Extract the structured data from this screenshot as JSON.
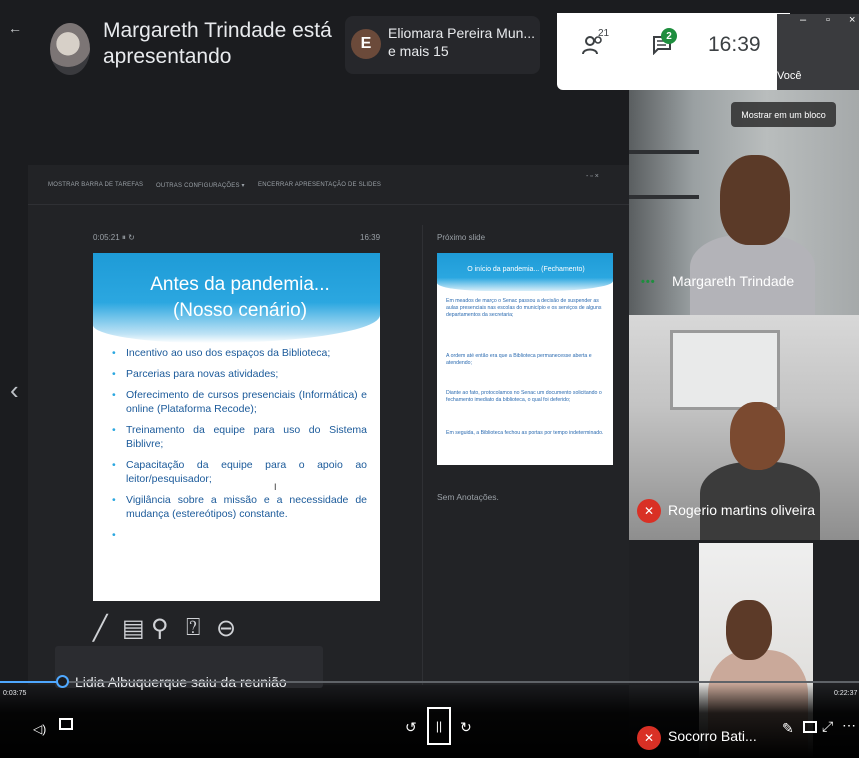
{
  "header": {
    "presenter": "Margareth Trindade está apresentando",
    "participant_name": "Eliomara Pereira Mun...",
    "participant_more": "e mais 15",
    "participant_initial": "E",
    "people_count": "21",
    "chat_badge": "2",
    "time": "16:39",
    "self_label": "Você"
  },
  "presentation": {
    "toolbar": [
      "MOSTRAR BARRA DE TAREFAS",
      "OUTRAS CONFIGURAÇÕES ▾",
      "ENCERRAR APRESENTAÇÃO DE SLIDES"
    ],
    "window_controls": "-  ▫  ×",
    "timer": "0:05:21  ⏸  ↻",
    "clock": "16:39",
    "next_label": "Próximo slide",
    "notes_label": "Sem Anotações.",
    "main_slide": {
      "title": "Antes da pandemia... (Nosso cenário)",
      "bullets": [
        "Incentivo ao uso dos espaços da Biblioteca;",
        "Parcerias para novas atividades;",
        "Oferecimento de cursos presenciais (Informática) e online (Plataforma Recode);",
        "Treinamento da equipe para uso do Sistema Biblivre;",
        "Capacitação da equipe para o apoio ao leitor/pesquisador;",
        "Vigilância sobre a missão e a necessidade de mudança (estereótipos) constante."
      ]
    },
    "next_slide": {
      "title": "O início da pandemia... (Fechamento)",
      "paragraphs": [
        "Em meados de março o Senac passou a decisão de suspender as aulas presenciais nas escolas do município e os serviços de alguns departamentos da secretaria;",
        "A ordem até então era que a Biblioteca permanecesse aberta e atendendo;",
        "Diante ao fato, protocolamos no Senac um documento solicitando o fechamento imediato da biblioteca, o qual foi deferido;",
        "Em seguida, a Biblioteca fechou as portas por tempo indeterminado."
      ]
    },
    "tools": {
      "pen": "╱",
      "slides": "▤",
      "zoom": "⚲",
      "pointer": "⍰",
      "more": "⊖"
    }
  },
  "participants": {
    "show_in_tile": "Mostrar em um bloco",
    "tile1": "Margareth Trindade",
    "tile2": "Rogerio martins oliveira",
    "tile3": "Socorro Bati..."
  },
  "player": {
    "notification": "Lidia Albuquerque saiu da reunião",
    "elapsed": "0:03:75",
    "total": "0:22:37",
    "pause_symbol": "||"
  },
  "colors": {
    "accent": "#4fa8ff",
    "slide_blue": "#1e9bd7",
    "mute_red": "#d93025",
    "chat_green": "#1e8e3e"
  }
}
